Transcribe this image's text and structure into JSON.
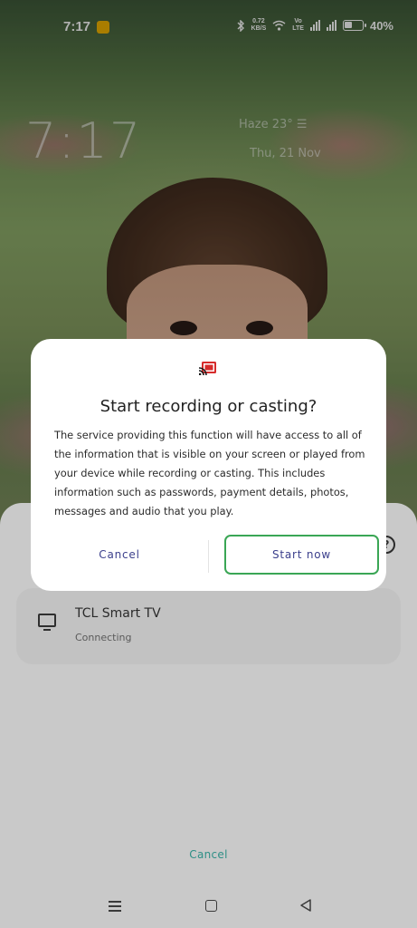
{
  "status_bar": {
    "time": "7:17",
    "net_speed_value": "0.72",
    "net_speed_unit": "KB/S",
    "volte_top": "Vo",
    "volte_bottom": "LTE",
    "battery_text": "40%",
    "battery_level": 0.4,
    "notification_color": "#f2b400"
  },
  "lockscreen": {
    "clock": "7:17",
    "weather": "Haze 23°",
    "date": "Thu, 21 Nov"
  },
  "dialog": {
    "icon": "cast-icon",
    "title": "Start recording or casting?",
    "body": "The service providing this function will have access to all of the information that is visible on your screen or played from your device while recording or casting. This includes information such as passwords, payment details, photos, messages and audio that you play.",
    "cancel_label": "Cancel",
    "start_label": "Start now",
    "accent_color": "#3b3f8c",
    "highlight_color": "#3aa655"
  },
  "cast_sheet": {
    "devices": [
      {
        "name": "TCL Smart TV",
        "status": "Connecting",
        "icon": "tv-icon"
      }
    ],
    "cancel_label": "Cancel",
    "cancel_color": "#2e8f86"
  },
  "navbar": {
    "icons": [
      "menu-icon",
      "home-icon",
      "back-icon"
    ]
  }
}
